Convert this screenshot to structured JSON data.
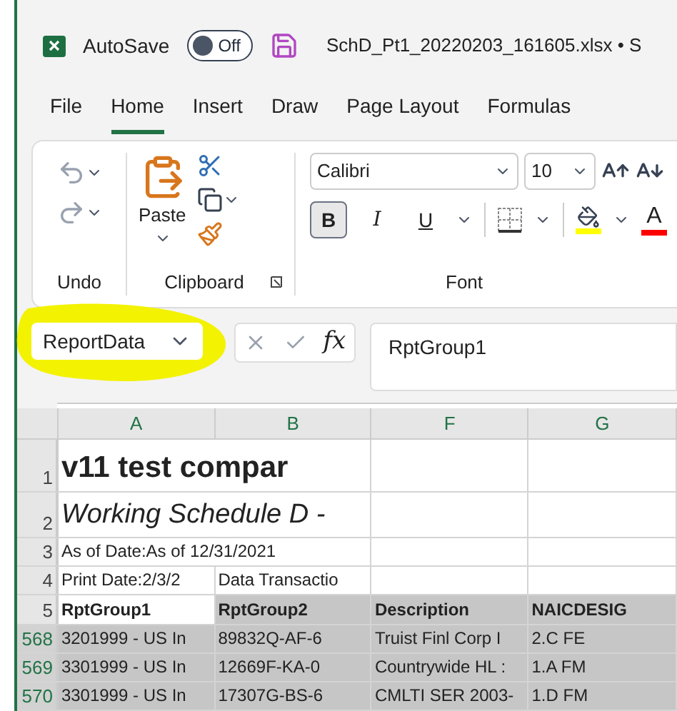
{
  "window": {
    "autosave_label": "AutoSave",
    "autosave": {
      "on": false,
      "label": "Off"
    },
    "title": "SchD_Pt1_20220203_161605.xlsx • S"
  },
  "tabs": [
    {
      "label": "File",
      "selected": false
    },
    {
      "label": "Home",
      "selected": true
    },
    {
      "label": "Insert",
      "selected": false
    },
    {
      "label": "Draw",
      "selected": false
    },
    {
      "label": "Page Layout",
      "selected": false
    },
    {
      "label": "Formulas",
      "selected": false
    }
  ],
  "ribbon": {
    "undo_group": {
      "label": "Undo"
    },
    "clipboard_group": {
      "label": "Clipboard",
      "paste_label": "Paste"
    },
    "font_group": {
      "label": "Font",
      "font_name": "Calibri",
      "font_size": "10",
      "font_color_label": "A",
      "format_buttons": [
        {
          "kind": "bold",
          "label": "B",
          "selected": true
        },
        {
          "kind": "italic",
          "label": "I",
          "selected": false
        },
        {
          "kind": "underline",
          "label": "U",
          "selected": false
        }
      ]
    }
  },
  "formula_bar": {
    "name_box": "ReportData",
    "fx_label": "fx",
    "value": "RptGroup1"
  },
  "grid": {
    "columns": [
      "A",
      "B",
      "F",
      "G"
    ],
    "rows": [
      {
        "number": "1",
        "kind": "title",
        "selected": false,
        "cells": [
          "v11 test compar"
        ]
      },
      {
        "number": "2",
        "kind": "subtitle",
        "selected": false,
        "cells": [
          "Working Schedule D -"
        ]
      },
      {
        "number": "3",
        "kind": "text",
        "selected": false,
        "cells": [
          "As of Date:As of 12/31/2021"
        ]
      },
      {
        "number": "4",
        "kind": "text",
        "selected": false,
        "cells": [
          "Print Date:2/3/2",
          "Data Transactio"
        ]
      },
      {
        "number": "5",
        "kind": "header",
        "selected": true,
        "first_cell_active": true,
        "cells": [
          "RptGroup1",
          "RptGroup2",
          "Description",
          "NAICDESIG"
        ]
      },
      {
        "number": "568",
        "kind": "data",
        "selected": true,
        "cells": [
          "3201999 - US In",
          "89832Q-AF-6",
          "Truist Finl Corp I",
          "2.C FE"
        ]
      },
      {
        "number": "569",
        "kind": "data",
        "selected": true,
        "cells": [
          "3301999 - US In",
          "12669F-KA-0",
          "Countrywide HL :",
          "1.A FM"
        ]
      },
      {
        "number": "570",
        "kind": "data",
        "selected": true,
        "cells": [
          "3301999 - US In",
          "17307G-BS-6",
          "CMLTI SER 2003-",
          "1.D FM"
        ]
      }
    ]
  }
}
